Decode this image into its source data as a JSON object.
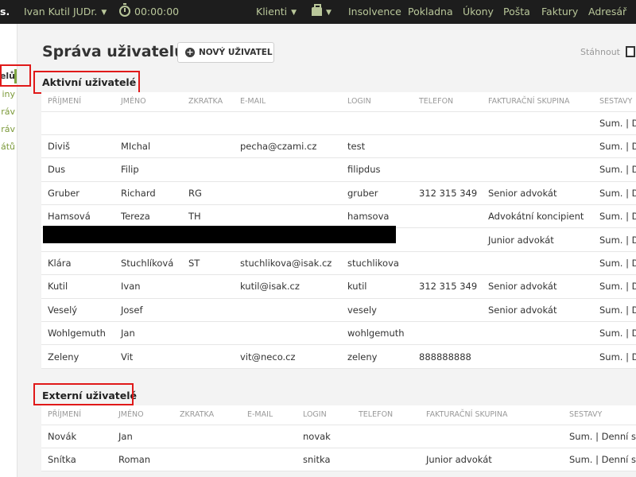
{
  "topbar": {
    "brand": "s.",
    "user": "Ivan Kutil JUDr.",
    "timer": "00:00:00",
    "nav": [
      "Klienti",
      "Insolvence",
      "Pokladna",
      "Úkony",
      "Pošta",
      "Faktury",
      "Adresář"
    ]
  },
  "sidebar": {
    "items": [
      "elů",
      "iny",
      "ráv",
      "ráv",
      "átů"
    ]
  },
  "page": {
    "title": "Správa uživatelů",
    "new_user_label": "NOVÝ UŽIVATEL",
    "download_label": "Stáhnout"
  },
  "active": {
    "title": "Aktivní uživatelé",
    "headers": [
      "PŘÍJMENÍ",
      "JMÉNO",
      "ZKRATKA",
      "E-MAIL",
      "LOGIN",
      "TELEFON",
      "FAKTURAČNÍ SKUPINA",
      "SESTAVY"
    ],
    "rows": [
      [
        "",
        "",
        "",
        "",
        "",
        "",
        "",
        "Sum. | De"
      ],
      [
        "Diviš",
        "MIchal",
        "",
        "pecha@czami.cz",
        "test",
        "",
        "",
        "Sum. | De"
      ],
      [
        "Dus",
        "Filip",
        "",
        "",
        "filipdus",
        "",
        "",
        "Sum. | De"
      ],
      [
        "Gruber",
        "Richard",
        "RG",
        "",
        "gruber",
        "312 315 349",
        "Senior advokát",
        "Sum. | De"
      ],
      [
        "Hamsová",
        "Tereza",
        "TH",
        "",
        "hamsova",
        "",
        "Advokátní koncipient",
        "Sum. | De"
      ],
      [
        "",
        "",
        "",
        "",
        "",
        "",
        "Junior advokát",
        "Sum. | De"
      ],
      [
        "Klára",
        "Stuchlíková",
        "ST",
        "stuchlikova@isak.cz",
        "stuchlikova",
        "",
        "",
        "Sum. | De"
      ],
      [
        "Kutil",
        "Ivan",
        "",
        "kutil@isak.cz",
        "kutil",
        "312 315 349",
        "Senior advokát",
        "Sum. | De"
      ],
      [
        "Veselý",
        "Josef",
        "",
        "",
        "vesely",
        "",
        "Senior advokát",
        "Sum. | De"
      ],
      [
        "Wohlgemuth",
        "Jan",
        "",
        "",
        "wohlgemuth",
        "",
        "",
        "Sum. | De"
      ],
      [
        "Zeleny",
        "Vit",
        "",
        "vit@neco.cz",
        "zeleny",
        "888888888",
        "",
        "Sum. | De"
      ]
    ]
  },
  "external": {
    "title": "Externí uživatelé",
    "headers": [
      "PŘÍJMENÍ",
      "JMÉNO",
      "ZKRATKA",
      "E-MAIL",
      "LOGIN",
      "TELEFON",
      "FAKTURAČNÍ SKUPINA",
      "SESTAVY"
    ],
    "rows": [
      [
        "Novák",
        "Jan",
        "",
        "",
        "novak",
        "",
        "",
        "Sum. | Denní sta"
      ],
      [
        "Snítka",
        "Roman",
        "",
        "",
        "snitka",
        "",
        "Junior advokát",
        "Sum. | Denní sta"
      ]
    ]
  }
}
